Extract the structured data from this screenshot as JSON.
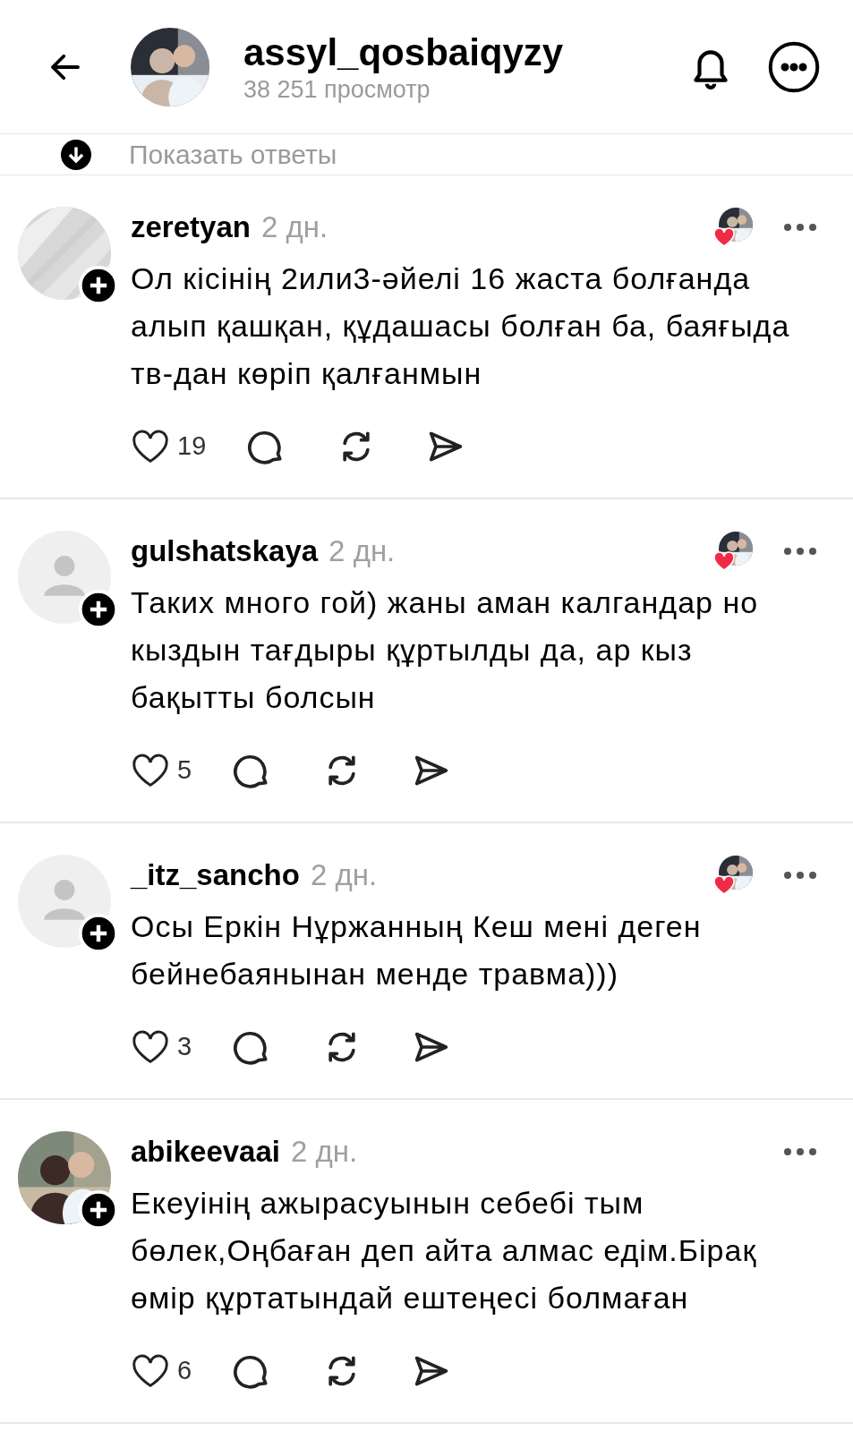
{
  "header": {
    "username": "assyl_qosbaiqyzy",
    "views": "38 251 просмотр"
  },
  "replies_link": {
    "label": "Показать ответы"
  },
  "comments": [
    {
      "username": "zeretyan",
      "time": "2 дн.",
      "has_photo": true,
      "author_liked": true,
      "text": "Ол кісінің 2или3-әйелі 16 жаста болғанда алып қашқан, құдашасы болған ба, баяғыда тв-дан көріп қалғанмын",
      "likes": "19"
    },
    {
      "username": "gulshatskaya",
      "time": "2 дн.",
      "has_photo": false,
      "author_liked": true,
      "text": "Таких много гой) жаны аман калгандар но кыздын тағдыры құртылды да, ар кыз бақытты болсын",
      "likes": "5"
    },
    {
      "username": "_itz_sancho",
      "time": "2 дн.",
      "has_photo": false,
      "author_liked": true,
      "text": "Осы Еркін Нұржанның Кеш мені деген бейнебаянынан менде травма)))",
      "likes": "3"
    },
    {
      "username": "abikeevaai",
      "time": "2 дн.",
      "has_photo": true,
      "author_liked": false,
      "text": "Екеуінің ажырасуынын себебі тым бөлек,Оңбаған деп айта алмас едім.Бірақ өмір құртатындай ештеңесі болмаған",
      "likes": "6"
    }
  ]
}
